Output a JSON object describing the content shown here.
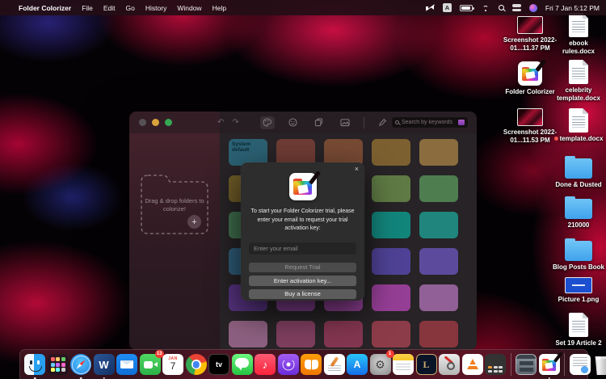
{
  "menubar": {
    "apple_logo": "",
    "app_name": "Folder Colorizer",
    "menus": [
      "File",
      "Edit",
      "Go",
      "History",
      "Window",
      "Help"
    ],
    "status_icons": [
      "volume-muted",
      "input-source-a",
      "battery",
      "wifi",
      "spotlight",
      "control-center",
      "siri"
    ],
    "input_source_label": "A",
    "clock": "Fri 7 Jan 5:12 PM"
  },
  "desktop": {
    "column1": [
      {
        "type": "screenshot",
        "label": "Screenshot 2022-01...11.37 PM"
      },
      {
        "type": "app",
        "label": "Folder Colorizer"
      },
      {
        "type": "screenshot",
        "label": "Screenshot 2022-01...11.53 PM"
      }
    ],
    "column2": [
      {
        "type": "docx",
        "label": "ebook rules.docx"
      },
      {
        "type": "docx",
        "label": "celebrity template.docx"
      },
      {
        "type": "docx",
        "label": "template.docx",
        "tag": "red"
      },
      {
        "type": "folder",
        "label": "Done & Dusted"
      },
      {
        "type": "folder",
        "label": "210000"
      },
      {
        "type": "folder",
        "label": "Blog Posts Book"
      },
      {
        "type": "image",
        "label": "Picture 1.png"
      },
      {
        "type": "docx",
        "label": "Set 19 Article 2"
      }
    ]
  },
  "window": {
    "toolbar": {
      "undo": "↶",
      "redo": "↷",
      "search_placeholder": "Search by keywords"
    },
    "sidebar": {
      "dropzone_text": "Drag & drop folders to colorize!",
      "plus": "+"
    },
    "grid": {
      "first_label": "System default",
      "rows": [
        [
          "#2b6173",
          "#6e3c34",
          "#774a33",
          "#7d6030",
          "#8a6c3e"
        ],
        [
          "#6d5a26",
          "#6f6030",
          "#647036",
          "#5f7a44",
          "#4e7d50"
        ],
        [
          "#3e6d4c",
          "#2f7a64",
          "#1f8076",
          "#12857b",
          "#1f857d"
        ],
        [
          "#2e5b76",
          "#3e4b88",
          "#4b4090",
          "#4f4296",
          "#5c4b9c"
        ],
        [
          "#55327e",
          "#7c3c86",
          "#8c3e90",
          "#953e95",
          "#916096"
        ],
        [
          "#8d6080",
          "#7e3e5e",
          "#843650",
          "#8c3c48",
          "#88363e"
        ]
      ]
    }
  },
  "modal": {
    "close": "×",
    "body_text": "To start your Folder Colorizer trial, please enter your email to request your trial activation key:",
    "email_placeholder": "Enter your email",
    "request_trial_label": "Request Trial",
    "enter_key_label": "Enter activation key...",
    "buy_license_label": "Buy a license"
  },
  "dock": {
    "items": [
      {
        "name": "finder",
        "running": true
      },
      {
        "name": "launchpad"
      },
      {
        "name": "safari",
        "running": true
      },
      {
        "name": "word",
        "glyph": "W",
        "running": true
      },
      {
        "name": "mail"
      },
      {
        "name": "facetime",
        "badge": "13"
      },
      {
        "name": "calendar",
        "month": "JAN",
        "day": "7"
      },
      {
        "name": "chrome"
      },
      {
        "name": "appletv",
        "glyph": "tv"
      },
      {
        "name": "messages"
      },
      {
        "name": "music",
        "glyph": "♪"
      },
      {
        "name": "podcasts"
      },
      {
        "name": "books"
      },
      {
        "name": "pages"
      },
      {
        "name": "appstore",
        "glyph": "A"
      },
      {
        "name": "settings",
        "glyph": "⚙",
        "badge": "1"
      },
      {
        "name": "notes"
      },
      {
        "name": "league-of-legends",
        "glyph": "L"
      },
      {
        "name": "utility"
      },
      {
        "name": "vlc"
      },
      {
        "name": "calculator"
      },
      {
        "name": "separator"
      },
      {
        "name": "minimized-window"
      },
      {
        "name": "folder-colorizer",
        "running": true
      },
      {
        "name": "separator"
      },
      {
        "name": "license-document"
      },
      {
        "name": "trash"
      }
    ]
  }
}
